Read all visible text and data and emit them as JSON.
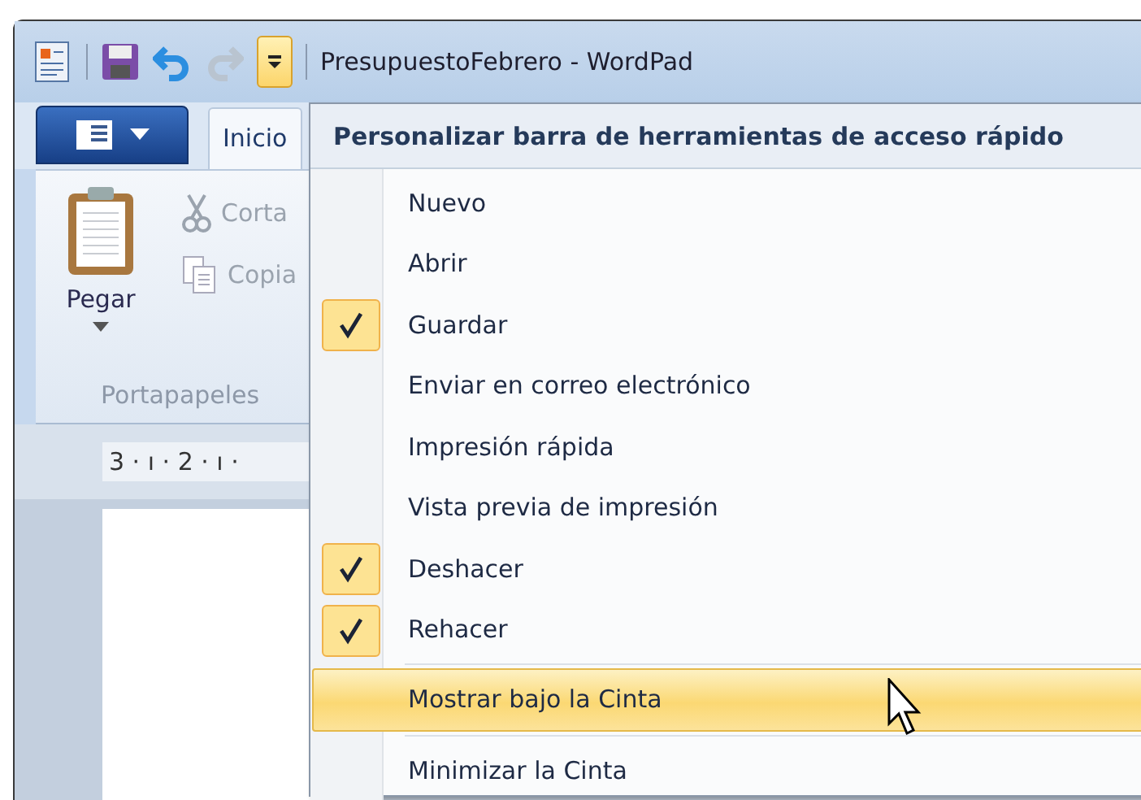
{
  "window": {
    "title": "PresupuestoFebrero - WordPad"
  },
  "quick_access_toolbar": {
    "customize_expanded": true
  },
  "ribbon": {
    "tabs": [
      {
        "label": "Inicio",
        "selected": true
      }
    ],
    "groups": [
      {
        "label": "Portapapeles",
        "buttons": [
          {
            "label": "Pegar",
            "kind": "large"
          },
          {
            "label": "Corta",
            "kind": "small"
          },
          {
            "label": "Copia",
            "kind": "small"
          }
        ]
      }
    ]
  },
  "ruler": {
    "text": "3 · ı · 2 · ı ·"
  },
  "menu": {
    "title": "Personalizar barra de herramientas de acceso rápido",
    "groups": [
      {
        "items": [
          {
            "label": "Nuevo",
            "checked": false,
            "highlighted": false
          },
          {
            "label": "Abrir",
            "checked": false,
            "highlighted": false
          },
          {
            "label": "Guardar",
            "checked": true,
            "highlighted": false
          },
          {
            "label": "Enviar en correo electrónico",
            "checked": false,
            "highlighted": false
          },
          {
            "label": "Impresión rápida",
            "checked": false,
            "highlighted": false
          },
          {
            "label": "Vista previa de impresión",
            "checked": false,
            "highlighted": false
          },
          {
            "label": "Deshacer",
            "checked": true,
            "highlighted": false
          },
          {
            "label": "Rehacer",
            "checked": true,
            "highlighted": false
          }
        ]
      },
      {
        "items": [
          {
            "label": "Mostrar bajo la Cinta",
            "checked": false,
            "highlighted": true
          }
        ]
      },
      {
        "items": [
          {
            "label": "Minimizar la Cinta",
            "checked": false,
            "highlighted": false
          }
        ]
      }
    ]
  }
}
